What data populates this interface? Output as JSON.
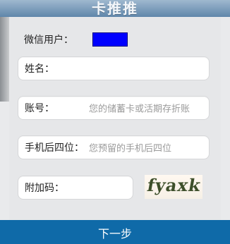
{
  "header": {
    "title": "卡推推"
  },
  "user": {
    "label": "微信用户："
  },
  "fields": {
    "name": {
      "label": "姓名：",
      "hint": ""
    },
    "account": {
      "label": "账号：",
      "hint": "您的储蓄卡或活期存折账"
    },
    "phone_last4": {
      "label": "手机后四位：",
      "hint": "您预留的手机后四位"
    },
    "captcha_code": {
      "label": "附加码：",
      "hint": ""
    }
  },
  "captcha": {
    "text": "fyaxk"
  },
  "footer": {
    "next_label": "下一步"
  },
  "colors": {
    "blue_bar": "#0f6aa8",
    "user_box": "#0000ff"
  }
}
